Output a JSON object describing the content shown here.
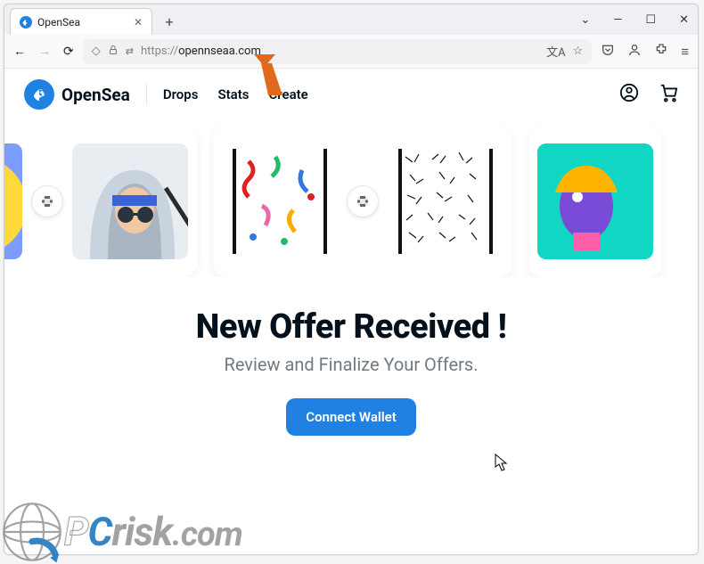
{
  "browser": {
    "tab_title": "OpenSea",
    "url_protocol": "https://",
    "url_domain": "opennseaa.com"
  },
  "header": {
    "brand": "OpenSea",
    "nav": {
      "drops": "Drops",
      "stats": "Stats",
      "create": "Create"
    }
  },
  "hero": {
    "title": "New Offer Received !",
    "subtitle": "Review and Finalize Your Offers.",
    "cta": "Connect Wallet"
  },
  "watermark": {
    "text": "PCrisk.com",
    "p": "P",
    "c": "C",
    "rest": "risk",
    "com": ".com"
  },
  "icons": {
    "back": "←",
    "forward": "→",
    "reload": "⟳",
    "shield": "◇",
    "lock": "🔒",
    "switch": "⇄",
    "translate": "⅄",
    "star": "☆",
    "pocket": "⌄",
    "account": "◯",
    "ext": "⧉",
    "menu": "≡",
    "chevron": "⌄",
    "minimize": "—",
    "maximize": "☐",
    "close_win": "✕",
    "close_tab": "✕",
    "newtab": "+",
    "profile": "◯",
    "cart": "🛒",
    "link": "⛓"
  }
}
